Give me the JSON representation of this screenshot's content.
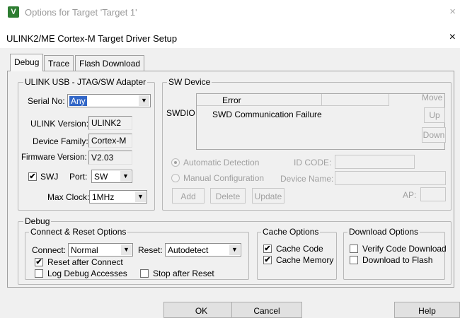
{
  "background_window": {
    "title": "Options for Target 'Target 1'",
    "icon": "uvision-app-icon",
    "close_label": "×"
  },
  "dialog": {
    "title": "ULINK2/ME Cortex-M Target Driver Setup",
    "close_label": "×"
  },
  "tabs": [
    {
      "label": "Debug",
      "active": true
    },
    {
      "label": "Trace",
      "active": false
    },
    {
      "label": "Flash Download",
      "active": false
    }
  ],
  "adapter": {
    "legend": "ULINK USB - JTAG/SW Adapter",
    "serial_label": "Serial No:",
    "serial_value": "Any",
    "version_label": "ULINK Version:",
    "version_value": "ULINK2",
    "family_label": "Device Family:",
    "family_value": "Cortex-M",
    "firmware_label": "Firmware Version:",
    "firmware_value": "V2.03",
    "swj_label": "SWJ",
    "swj_checked": true,
    "port_label": "Port:",
    "port_value": "SW",
    "clock_label": "Max Clock:",
    "clock_value": "1MHz"
  },
  "sw_device": {
    "legend": "SW Device",
    "row_label": "SWDIO",
    "columns": [
      "Error",
      ""
    ],
    "rows": [
      [
        "SWD Communication Failure",
        ""
      ]
    ],
    "move_label": "Move",
    "up_label": "Up",
    "down_label": "Down",
    "auto_detect_label": "Automatic Detection",
    "manual_config_label": "Manual Configuration",
    "id_code_label": "ID CODE:",
    "device_name_label": "Device Name:",
    "add_label": "Add",
    "delete_label": "Delete",
    "update_label": "Update",
    "ap_label": "AP:"
  },
  "debug": {
    "legend": "Debug",
    "connect_reset_legend": "Connect & Reset Options",
    "connect_label": "Connect:",
    "connect_value": "Normal",
    "reset_label": "Reset:",
    "reset_value": "Autodetect",
    "reset_after_connect_label": "Reset after Connect",
    "reset_after_connect_checked": true,
    "log_debug_label": "Log Debug Accesses",
    "log_debug_checked": false,
    "stop_after_reset_label": "Stop after Reset",
    "stop_after_reset_checked": false,
    "cache_legend": "Cache Options",
    "cache_code_label": "Cache Code",
    "cache_code_checked": true,
    "cache_memory_label": "Cache Memory",
    "cache_memory_checked": true,
    "download_legend": "Download Options",
    "verify_label": "Verify Code Download",
    "verify_checked": false,
    "download_flash_label": "Download to Flash",
    "download_flash_checked": false
  },
  "footer": {
    "ok_label": "OK",
    "cancel_label": "Cancel",
    "help_label": "Help"
  },
  "check_mark": "✔",
  "dropdown_arrow": "▼",
  "colors": {
    "selection": "#3166c7",
    "icon_green": "#2e7d32",
    "disabled_text": "#a0a0a0"
  }
}
